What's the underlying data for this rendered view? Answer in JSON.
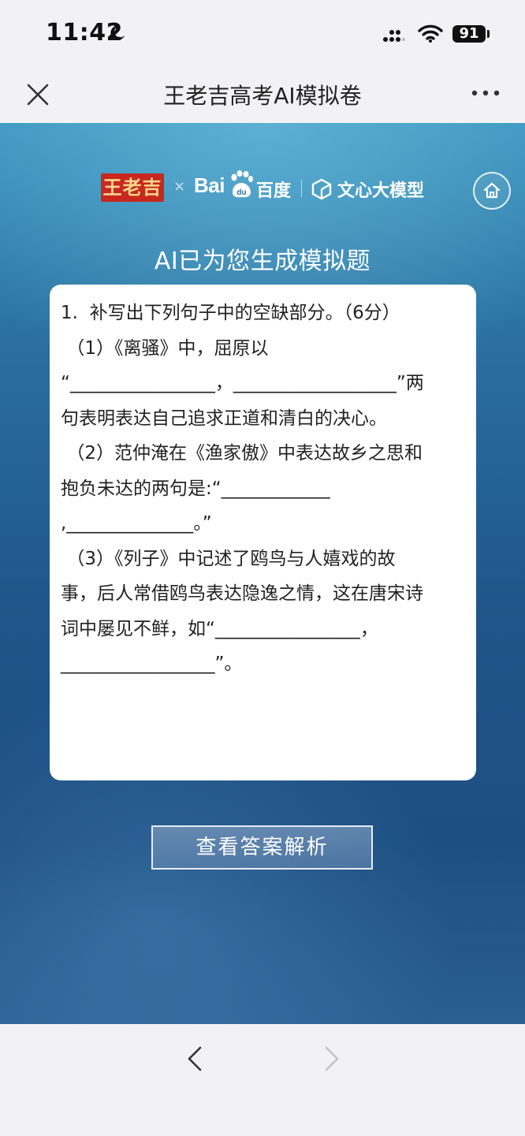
{
  "status_bar": {
    "time": "11:42",
    "battery": "91"
  },
  "nav": {
    "title": "王老吉高考AI模拟卷"
  },
  "brand": {
    "wanglaoji": "王老吉",
    "x": "×",
    "baidu_en": "Bai",
    "baidu_cn": "百度",
    "ernie": "文心大模型"
  },
  "main": {
    "heading": "AI已为您生成模拟题",
    "question_text": "1.  补写出下列句子中的空缺部分。（6分）\n （1）《离骚》中，屈原以\n“________________，__________________”两\n句表明表达自己追求正道和清白的决心。\n （2）范仲淹在《渔家傲》中表达故乡之思和\n抱负未达的两句是:“____________\n,______________。”\n （3）《列子》中记述了鸥鸟与人嬉戏的故\n事，后人常借鸥鸟表达隐逸之情，这在唐宋诗\n词中屡见不鲜，如“________________，\n_________________”。",
    "answer_button": "查看答案解析"
  },
  "colors": {
    "accent_red": "#c8281f",
    "background_blue": "#1f5588"
  },
  "icons": {
    "close": "close-icon",
    "more": "more-icon",
    "home": "home-icon",
    "back": "chevron-left-icon",
    "forward": "chevron-right-icon"
  }
}
